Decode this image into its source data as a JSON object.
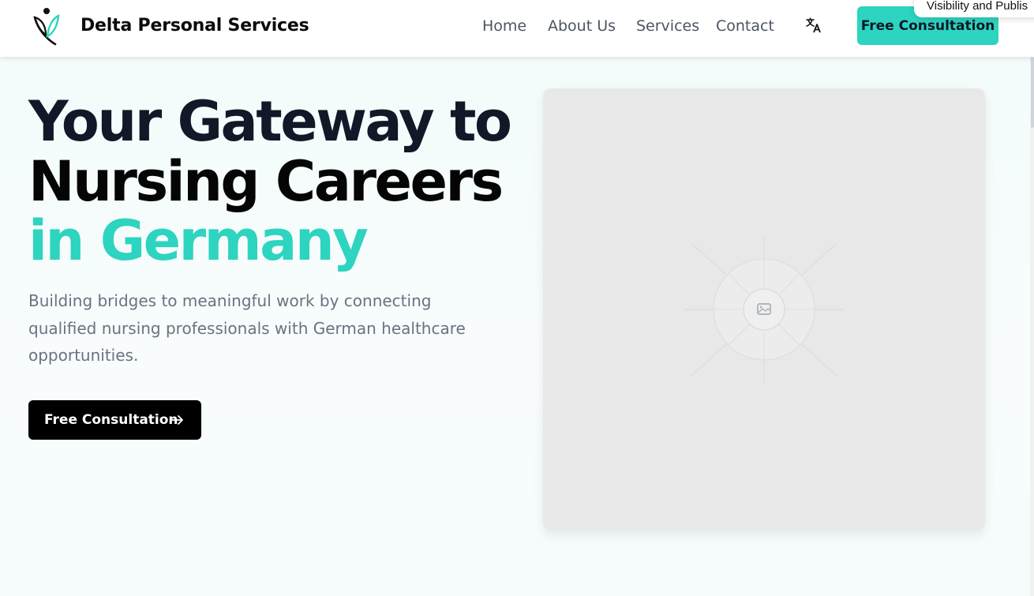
{
  "header": {
    "brand": "Delta Personal Services",
    "nav": [
      {
        "label": "Home"
      },
      {
        "label": "About Us"
      },
      {
        "label": "Services"
      },
      {
        "label": "Contact"
      }
    ],
    "language_icon": "translate-icon",
    "cta_label": "Free Consultation"
  },
  "popup": {
    "text": "Visibility and Publis"
  },
  "hero": {
    "title_line1": "Your Gateway to",
    "title_line2": "Nursing Careers",
    "title_line3": "in Germany",
    "description": "Building bridges to meaningful work by connecting qualified nursing professionals with German healthcare opportunities.",
    "cta_label": "Free Consultation",
    "cta_icon": "arrow-right-icon",
    "image_icon": "image-placeholder-icon"
  },
  "colors": {
    "accent": "#2dd4bf",
    "dark": "#111827",
    "muted": "#6b7280"
  }
}
